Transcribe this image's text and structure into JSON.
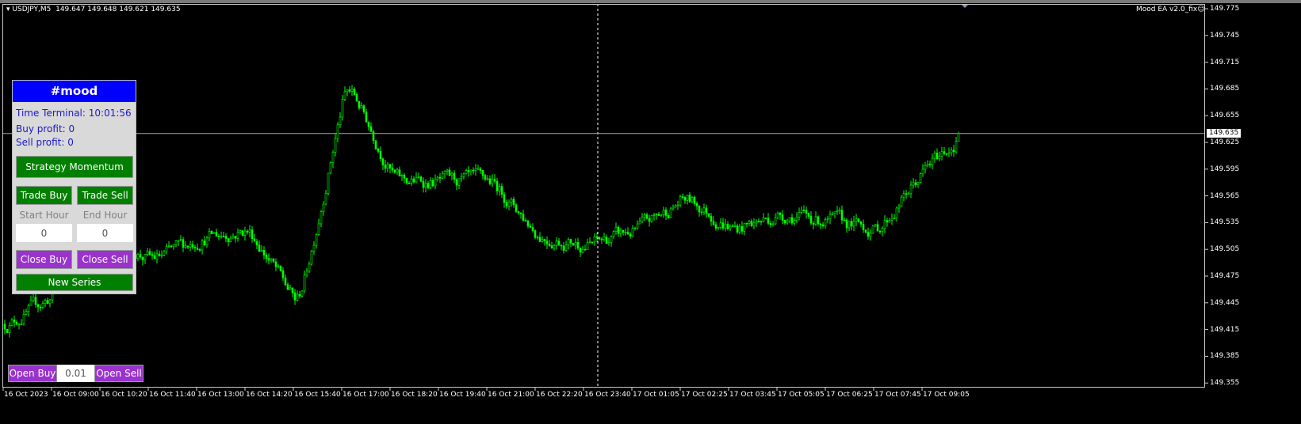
{
  "header": {
    "symbol_info": "USDJPY,M5  149.647 149.648 149.621 149.635",
    "ea_label": "Mood EA  v2.0_fix",
    "ea_icon": "smiley-icon"
  },
  "colors": {
    "background": "#000000",
    "candle": "#00ff00",
    "candle_body_up": "#000000",
    "panel_title_bg": "#0000ff",
    "button_green": "#007f00",
    "button_purple": "#9a33cc",
    "info_text": "#1a1ac8"
  },
  "price_axis": {
    "ticks": [
      "149.775",
      "149.745",
      "149.715",
      "149.685",
      "149.655",
      "149.625",
      "149.595",
      "149.565",
      "149.535",
      "149.505",
      "149.475",
      "149.445",
      "149.415",
      "149.385",
      "149.355"
    ],
    "current_price": "149.635"
  },
  "time_axis": {
    "ticks": [
      "16 Oct 2023",
      "16 Oct 09:00",
      "16 Oct 10:20",
      "16 Oct 11:40",
      "16 Oct 13:00",
      "16 Oct 14:20",
      "16 Oct 15:40",
      "16 Oct 17:00",
      "16 Oct 18:20",
      "16 Oct 19:40",
      "16 Oct 21:00",
      "16 Oct 22:20",
      "16 Oct 23:40",
      "17 Oct 01:05",
      "17 Oct 02:25",
      "17 Oct 03:45",
      "17 Oct 05:05",
      "17 Oct 06:25",
      "17 Oct 07:45",
      "17 Oct 09:05"
    ]
  },
  "chart_data": {
    "type": "candlestick",
    "timeframe": "M5",
    "ylim": [
      149.355,
      149.78
    ],
    "approx_close_at_ticks": [
      149.421,
      149.456,
      149.519,
      149.492,
      149.519,
      149.527,
      149.439,
      149.696,
      149.581,
      149.581,
      149.581,
      149.519,
      149.51,
      149.527,
      149.563,
      149.527,
      149.545,
      149.536,
      149.527,
      149.598
    ],
    "last": {
      "open": 149.647,
      "high": 149.648,
      "low": 149.621,
      "close": 149.635
    },
    "crosshair_time": "16 Oct 23:40"
  },
  "panel": {
    "title": "#mood",
    "time_terminal": "Time Terminal: 10:01:56",
    "buy_profit": "Buy profit: 0",
    "sell_profit": "Sell profit: 0",
    "strategy_button": "Strategy Momentum",
    "trade_buy": "Trade Buy",
    "trade_sell": "Trade Sell",
    "start_hour_label": "Start Hour",
    "end_hour_label": "End Hour",
    "start_hour_value": "0",
    "end_hour_value": "0",
    "close_buy": "Close Buy",
    "close_sell": "Close Sell",
    "new_series": "New Series"
  },
  "order_bar": {
    "open_buy": "Open Buy",
    "lot_value": "0.01",
    "open_sell": "Open Sell"
  }
}
